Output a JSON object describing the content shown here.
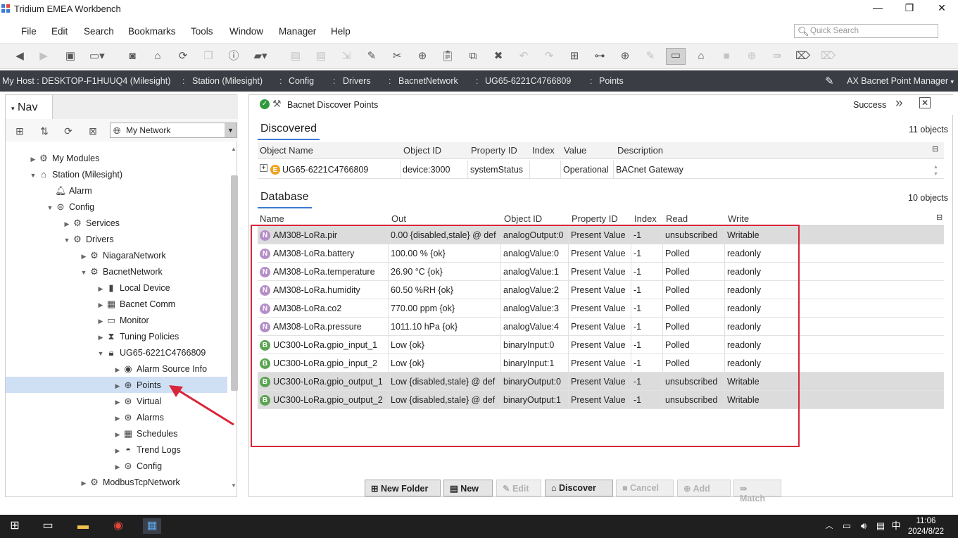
{
  "window": {
    "title": "Tridium EMEA Workbench",
    "minimize": "—",
    "maximize": "❐",
    "close": "✕"
  },
  "menu": [
    "File",
    "Edit",
    "Search",
    "Bookmarks",
    "Tools",
    "Window",
    "Manager",
    "Help"
  ],
  "quick_search": {
    "placeholder": "Quick Search"
  },
  "toolbar_icons": [
    "back",
    "forward",
    "home-folder",
    "side-bar",
    "camera",
    "home",
    "refresh",
    "copy",
    "properties",
    "open",
    "save",
    "save-all",
    "export",
    "edit",
    "cut",
    "add",
    "paste",
    "duplicate",
    "delete",
    "undo",
    "redo",
    "new-folder",
    "hierarchy",
    "new",
    "pencil",
    "manager-view",
    "plugins",
    "stop",
    "add-circle",
    "match",
    "tag",
    "tags"
  ],
  "pathbar": {
    "crumbs": [
      "My Host : DESKTOP-F1HUUQ4 (Milesight)",
      "Station (Milesight)",
      "Config",
      "Drivers",
      "BacnetNetwork",
      "UG65-6221C4766809",
      "Points"
    ],
    "view": "AX Bacnet Point Manager"
  },
  "nav": {
    "title": "Nav",
    "network": "My Network",
    "tree": [
      {
        "label": "My Modules",
        "icon": "modules",
        "indent": 2,
        "expanded": false
      },
      {
        "label": "Station (Milesight)",
        "icon": "station",
        "indent": 2,
        "expanded": true
      },
      {
        "label": "Alarm",
        "icon": "bell",
        "indent": 3,
        "expanded": null
      },
      {
        "label": "Config",
        "icon": "config",
        "indent": 3,
        "expanded": true
      },
      {
        "label": "Services",
        "icon": "services",
        "indent": 4,
        "expanded": false
      },
      {
        "label": "Drivers",
        "icon": "drivers",
        "indent": 4,
        "expanded": true
      },
      {
        "label": "NiagaraNetwork",
        "icon": "network",
        "indent": 5,
        "expanded": false
      },
      {
        "label": "BacnetNetwork",
        "icon": "network",
        "indent": 5,
        "expanded": true
      },
      {
        "label": "Local Device",
        "icon": "device",
        "indent": 6,
        "expanded": false
      },
      {
        "label": "Bacnet Comm",
        "icon": "comm",
        "indent": 6,
        "expanded": false
      },
      {
        "label": "Monitor",
        "icon": "monitor",
        "indent": 6,
        "expanded": false
      },
      {
        "label": "Tuning Policies",
        "icon": "tuning",
        "indent": 6,
        "expanded": false
      },
      {
        "label": "UG65-6221C4766809",
        "icon": "lock",
        "indent": 6,
        "expanded": true
      },
      {
        "label": "Alarm Source Info",
        "icon": "alarm-source",
        "indent": 7,
        "expanded": false
      },
      {
        "label": "Points",
        "icon": "points",
        "indent": 7,
        "expanded": false,
        "selected": true
      },
      {
        "label": "Virtual",
        "icon": "virtual",
        "indent": 7,
        "expanded": false
      },
      {
        "label": "Alarms",
        "icon": "alarms",
        "indent": 7,
        "expanded": false
      },
      {
        "label": "Schedules",
        "icon": "schedules",
        "indent": 7,
        "expanded": false
      },
      {
        "label": "Trend Logs",
        "icon": "trend",
        "indent": 7,
        "expanded": false
      },
      {
        "label": "Config",
        "icon": "config",
        "indent": 7,
        "expanded": false
      },
      {
        "label": "ModbusTcpNetwork",
        "icon": "network",
        "indent": 5,
        "expanded": false
      }
    ]
  },
  "status": {
    "job": "Bacnet Discover Points",
    "result": "Success"
  },
  "discovered": {
    "title": "Discovered",
    "count": "11 objects",
    "columns": [
      "Object Name",
      "Object ID",
      "Property ID",
      "Index",
      "Value",
      "Description"
    ],
    "rows": [
      [
        "UG65-6221C4766809",
        "device:3000",
        "systemStatus",
        "",
        "Operational",
        "BACnet Gateway"
      ]
    ]
  },
  "database": {
    "title": "Database",
    "count": "10 objects",
    "columns": [
      "Name",
      "Out",
      "Object ID",
      "Property ID",
      "Index",
      "Read",
      "Write"
    ],
    "rows": [
      {
        "type": "N",
        "name": "AM308-LoRa.pir",
        "out": "0.00 {disabled,stale} @ def",
        "oid": "analogOutput:0",
        "pid": "Present Value",
        "idx": "-1",
        "read": "unsubscribed",
        "write": "Writable",
        "gray": true
      },
      {
        "type": "N",
        "name": "AM308-LoRa.battery",
        "out": "100.00 % {ok}",
        "oid": "analogValue:0",
        "pid": "Present Value",
        "idx": "-1",
        "read": "Polled",
        "write": "readonly",
        "gray": false
      },
      {
        "type": "N",
        "name": "AM308-LoRa.temperature",
        "out": "26.90 °C {ok}",
        "oid": "analogValue:1",
        "pid": "Present Value",
        "idx": "-1",
        "read": "Polled",
        "write": "readonly",
        "gray": false
      },
      {
        "type": "N",
        "name": "AM308-LoRa.humidity",
        "out": "60.50 %RH {ok}",
        "oid": "analogValue:2",
        "pid": "Present Value",
        "idx": "-1",
        "read": "Polled",
        "write": "readonly",
        "gray": false
      },
      {
        "type": "N",
        "name": "AM308-LoRa.co2",
        "out": "770.00 ppm {ok}",
        "oid": "analogValue:3",
        "pid": "Present Value",
        "idx": "-1",
        "read": "Polled",
        "write": "readonly",
        "gray": false
      },
      {
        "type": "N",
        "name": "AM308-LoRa.pressure",
        "out": "1011.10 hPa {ok}",
        "oid": "analogValue:4",
        "pid": "Present Value",
        "idx": "-1",
        "read": "Polled",
        "write": "readonly",
        "gray": false
      },
      {
        "type": "B",
        "name": "UC300-LoRa.gpio_input_1",
        "out": "Low {ok}",
        "oid": "binaryInput:0",
        "pid": "Present Value",
        "idx": "-1",
        "read": "Polled",
        "write": "readonly",
        "gray": false
      },
      {
        "type": "B",
        "name": "UC300-LoRa.gpio_input_2",
        "out": "Low {ok}",
        "oid": "binaryInput:1",
        "pid": "Present Value",
        "idx": "-1",
        "read": "Polled",
        "write": "readonly",
        "gray": false
      },
      {
        "type": "B",
        "name": "UC300-LoRa.gpio_output_1",
        "out": "Low {disabled,stale} @ def",
        "oid": "binaryOutput:0",
        "pid": "Present Value",
        "idx": "-1",
        "read": "unsubscribed",
        "write": "Writable",
        "gray": true
      },
      {
        "type": "B",
        "name": "UC300-LoRa.gpio_output_2",
        "out": "Low {disabled,stale} @ def",
        "oid": "binaryOutput:1",
        "pid": "Present Value",
        "idx": "-1",
        "read": "unsubscribed",
        "write": "Writable",
        "gray": true
      }
    ]
  },
  "buttons": [
    {
      "label": "New Folder",
      "enabled": true
    },
    {
      "label": "New",
      "enabled": true
    },
    {
      "label": "Edit",
      "enabled": false
    },
    {
      "label": "Discover",
      "enabled": true
    },
    {
      "label": "Cancel",
      "enabled": false
    },
    {
      "label": "Add",
      "enabled": false
    },
    {
      "label": "Match",
      "enabled": false
    }
  ],
  "taskbar": {
    "time": "11:06",
    "date": "2024/8/22",
    "ime": "中"
  },
  "colors": {
    "pathbar": "#3a3d44",
    "highlight": "#d8263a",
    "selection": "#cfe0f5",
    "accent": "#3a7bd5"
  }
}
